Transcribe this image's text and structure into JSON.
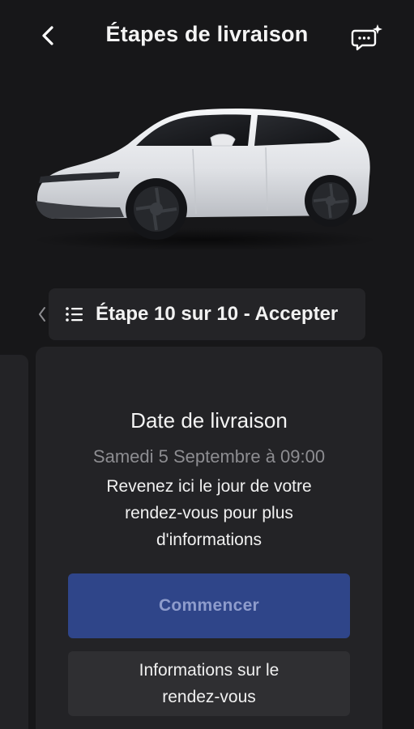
{
  "header": {
    "title": "Étapes de livraison",
    "back_icon": "chevron-left-icon",
    "chat_icon": "chat-sparkle-icon"
  },
  "vehicle": {
    "image_alt": "white-suv-image",
    "color": "#e8e9ec"
  },
  "step_selector": {
    "label": "Étape 10 sur 10 - Accepter",
    "list_icon": "list-icon",
    "prev_icon": "chevron-left-icon"
  },
  "delivery_card": {
    "title": "Date de livraison",
    "date": "Samedi 5 Septembre à 09:00",
    "message": "Revenez ici le jour de votre rendez-vous pour plus d'informations",
    "primary_button": "Commencer",
    "secondary_button": "Informations sur le rendez-vous"
  },
  "colors": {
    "background": "#171719",
    "card": "#232326",
    "primary_button": "#2f4589",
    "primary_button_text": "#8e9ccc",
    "muted_text": "#8d8d91"
  }
}
